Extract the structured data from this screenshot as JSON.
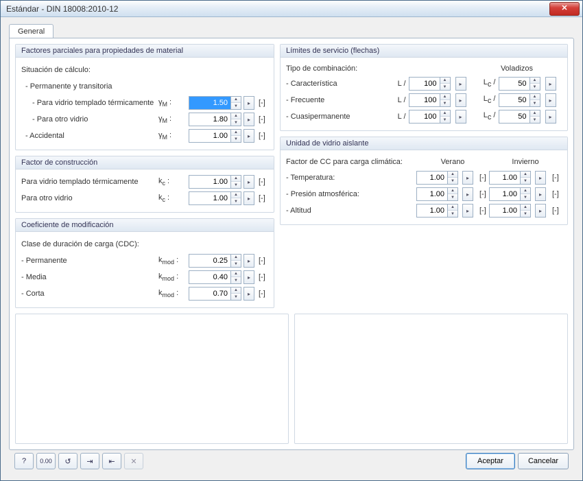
{
  "window": {
    "title": "Estándar - DIN 18008:2010-12"
  },
  "tabs": {
    "general": "General"
  },
  "buttons": {
    "accept": "Aceptar",
    "cancel": "Cancelar"
  },
  "icons": [
    "help-icon",
    "decimals-icon",
    "restore-icon",
    "import-icon",
    "export-icon",
    "x-icon"
  ],
  "factores": {
    "title": "Factores parciales para propiedades de material",
    "situacion": "Situación de cálculo:",
    "perm_trans": "- Permanente y transitoria",
    "templa": "- Para vidrio templado térmicamente",
    "otro": "- Para otro vidrio",
    "accidental": "- Accidental",
    "sym": "γM :",
    "v1": "1.50",
    "v2": "1.80",
    "v3": "1.00",
    "unit": "[-]"
  },
  "construc": {
    "title": "Factor de construcción",
    "templa": "Para vidrio templado térmicamente",
    "otro": "Para otro vidrio",
    "sym": "kc :",
    "v1": "1.00",
    "v2": "1.00",
    "unit": "[-]"
  },
  "kmod": {
    "title": "Coeficiente de modificación",
    "cdc": "Clase de duración de carga (CDC):",
    "permanente": "- Permanente",
    "media": "- Media",
    "corta": "- Corta",
    "sym": "kmod :",
    "v1": "0.25",
    "v2": "0.40",
    "v3": "0.70",
    "unit": "[-]"
  },
  "limites": {
    "title": "Límites de servicio (flechas)",
    "tipo": "Tipo de combinación:",
    "voladizos": "Voladizos",
    "caract": "- Característica",
    "frec": "- Frecuente",
    "cuasi": "- Cuasipermanente",
    "preL": "L /",
    "preLc": "Lc /",
    "a1": "100",
    "a2": "100",
    "a3": "100",
    "b1": "50",
    "b2": "50",
    "b3": "50"
  },
  "uva": {
    "title": "Unidad de vidrio aislante",
    "hdr": "Factor de CC para carga climática:",
    "verano": "Verano",
    "invierno": "Invierno",
    "temp": "- Temperatura:",
    "pres": "- Presión atmosférica:",
    "alt": "- Altitud",
    "v": [
      "1.00",
      "1.00",
      "1.00"
    ],
    "i": [
      "1.00",
      "1.00",
      "1.00"
    ],
    "unit": "[-]"
  }
}
